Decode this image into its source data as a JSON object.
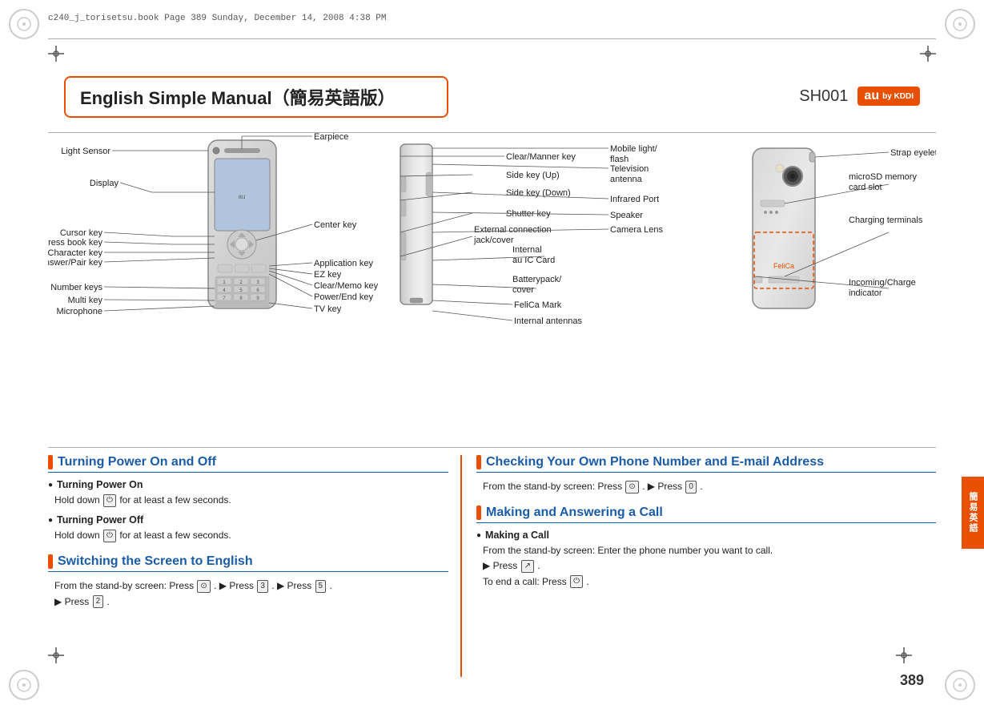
{
  "header": {
    "file_info": "c240_j_torisetsu.book  Page 389  Sunday, December 14, 2008  4:38 PM"
  },
  "title": {
    "main": "English Simple Manual（簡易英語版）",
    "model": "SH001",
    "brand": "au",
    "brand_sub": "by KDDI"
  },
  "diagram": {
    "front_labels": [
      "Light Sensor",
      "Earpiece",
      "Display",
      "Center key",
      "Cursor key",
      "Application key",
      "Address book key",
      "EZ key",
      "Mail/Character key",
      "Clear/Memo key",
      "Answer/Pair key",
      "Power/End key",
      "Number keys",
      "TV key",
      "Multi key",
      "Microphone"
    ],
    "side_labels": [
      "Clear/Manner key",
      "Mobile light/flash",
      "Side key (Up)",
      "Television antenna",
      "Side key (Down)",
      "Infrared Port",
      "Shutter key",
      "Speaker",
      "External connection jack/cover",
      "Camera Lens",
      "Internal au IC Card",
      "Batterypack/cover",
      "FeliCa Mark",
      "Internal antennas"
    ],
    "back_labels": [
      "Strap eyelet",
      "microSD memory card slot",
      "Charging terminals",
      "Incoming/Charge indicator"
    ]
  },
  "sections": {
    "turning_power": {
      "title": "Turning Power On and Off",
      "on_title": "Turning Power On",
      "on_text": "Hold down",
      "on_text2": "for at least a few seconds.",
      "off_title": "Turning Power Off",
      "off_text": "Hold down",
      "off_text2": "for at least a few seconds."
    },
    "switching_screen": {
      "title": "Switching the Screen to English",
      "text1": "From the stand-by screen: Press",
      "text1b": ".",
      "text1c": "▶ Press",
      "text1d": ".",
      "text1e": "▶ Press",
      "text1f": ".",
      "text2": "▶ Press",
      "text2b": "."
    },
    "checking_number": {
      "title": "Checking Your Own Phone Number and E-mail Address",
      "text": "From the stand-by screen: Press",
      "text_mid": ". ▶ Press"
    },
    "making_call": {
      "title": "Making and Answering a Call",
      "making_title": "Making a Call",
      "making_text1": "From the stand-by screen: Enter the phone number you want to call.",
      "making_text2": "▶ Press",
      "making_text2b": ".",
      "making_text3": "To end a call: Press",
      "making_text3b": "."
    }
  },
  "page_number": "389",
  "side_tab_text": "簡易英語"
}
